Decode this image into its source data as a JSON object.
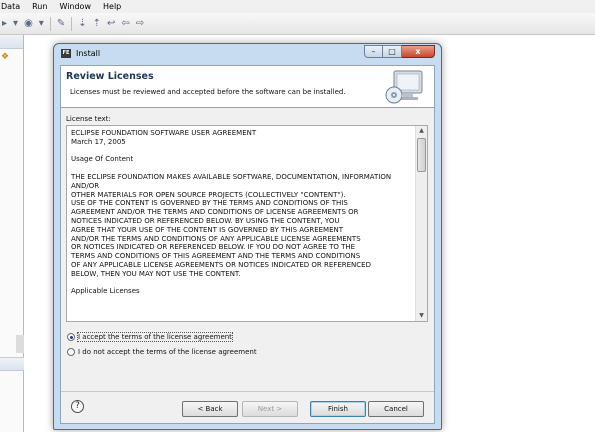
{
  "ide": {
    "menu": [
      "Data",
      "Run",
      "Window",
      "Help"
    ]
  },
  "dialog": {
    "app_icon_text": "FE",
    "title": "Install",
    "window_controls": {
      "minimize": "–",
      "maximize": "□",
      "close": "x"
    },
    "banner": {
      "heading": "Review Licenses",
      "subtitle": "Licenses must be reviewed and accepted before the software can be installed."
    },
    "license_label": "License text:",
    "license_lines": [
      "ECLIPSE FOUNDATION SOFTWARE USER AGREEMENT",
      "March 17, 2005",
      "",
      "Usage Of Content",
      "",
      "THE ECLIPSE FOUNDATION MAKES AVAILABLE SOFTWARE, DOCUMENTATION, INFORMATION",
      "AND/OR",
      "OTHER MATERIALS FOR OPEN SOURCE PROJECTS (COLLECTIVELY \"CONTENT\").",
      "USE OF THE CONTENT IS GOVERNED BY THE TERMS AND CONDITIONS OF THIS",
      "AGREEMENT AND/OR THE TERMS AND CONDITIONS OF LICENSE AGREEMENTS OR",
      "NOTICES INDICATED OR REFERENCED BELOW. BY USING THE CONTENT, YOU",
      "AGREE THAT YOUR USE OF THE CONTENT IS GOVERNED BY THIS AGREEMENT",
      "AND/OR THE TERMS AND CONDITIONS OF ANY APPLICABLE LICENSE AGREEMENTS",
      "OR NOTICES INDICATED OR REFERENCED BELOW. IF YOU DO NOT AGREE TO THE",
      "TERMS AND CONDITIONS OF THIS AGREEMENT AND THE TERMS AND CONDITIONS",
      "OF ANY APPLICABLE LICENSE AGREEMENTS OR NOTICES INDICATED OR REFERENCED",
      "BELOW, THEN YOU MAY NOT USE THE CONTENT.",
      "",
      "Applicable Licenses"
    ],
    "radio_accept": "I accept the terms of the license agreement",
    "radio_decline": "I do not accept the terms of the license agreement",
    "accept_selected": true,
    "help_glyph": "?",
    "buttons": {
      "back": "< Back",
      "next": "Next >",
      "finish": "Finish",
      "cancel": "Cancel"
    }
  }
}
